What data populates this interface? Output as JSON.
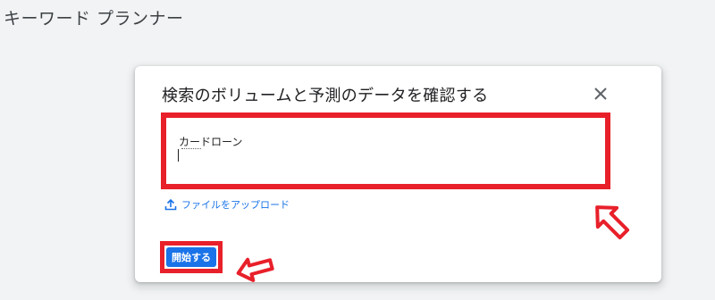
{
  "header": {
    "title": "キーワード プランナー"
  },
  "dialog": {
    "title": "検索のボリュームと予測のデータを確認する",
    "keywords_value": "カードローン",
    "upload_link_label": "ファイルをアップロード",
    "start_button_label": "開始する"
  },
  "colors": {
    "accent": "#1a73e8",
    "highlight": "#e8202a",
    "background": "#f1f3f4"
  },
  "icons": [
    "close-icon",
    "upload-icon",
    "arrow-annotation-icon"
  ]
}
